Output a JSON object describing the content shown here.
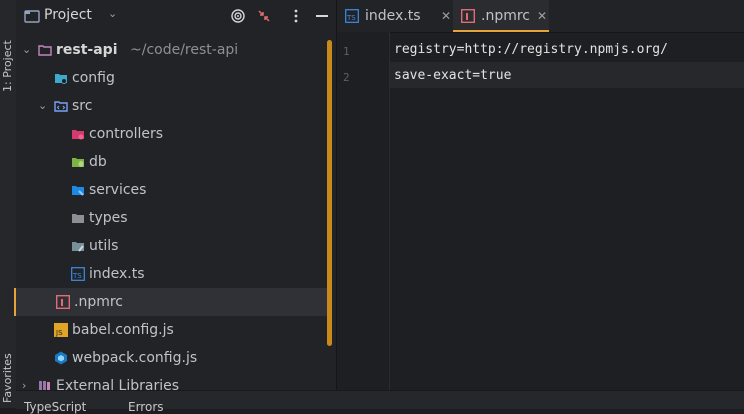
{
  "toolstrip": {
    "project_label": "1: Project",
    "favorites_label": "Favorites"
  },
  "project_panel": {
    "title": "Project",
    "tree": [
      {
        "label": "rest-api",
        "hint": "~/code/rest-api",
        "icon": "folder-icon"
      },
      {
        "label": "config",
        "icon": "folder-config-icon"
      },
      {
        "label": "src",
        "icon": "folder-source-icon"
      },
      {
        "label": "controllers",
        "icon": "folder-controllers-icon"
      },
      {
        "label": "db",
        "icon": "folder-db-icon"
      },
      {
        "label": "services",
        "icon": "folder-services-icon"
      },
      {
        "label": "types",
        "icon": "folder-icon"
      },
      {
        "label": "utils",
        "icon": "folder-utils-icon"
      },
      {
        "label": "index.ts",
        "icon": "typescript-file-icon"
      },
      {
        "label": ".npmrc",
        "icon": "npm-file-icon"
      },
      {
        "label": "babel.config.js",
        "icon": "javascript-file-icon"
      },
      {
        "label": "webpack.config.js",
        "icon": "webpack-file-icon"
      },
      {
        "label": "External Libraries",
        "icon": "libraries-icon"
      }
    ]
  },
  "bottom_tabs": [
    "TypeScript",
    "Errors"
  ],
  "editor": {
    "tabs": [
      {
        "label": "index.ts",
        "icon": "typescript-file-icon",
        "active": false
      },
      {
        "label": ".npmrc",
        "icon": "npm-file-icon",
        "active": true
      }
    ],
    "lines": [
      {
        "number": "1",
        "text": "registry=http://registry.npmjs.org/"
      },
      {
        "number": "2",
        "text": "save-exact=true"
      }
    ]
  },
  "colors": {
    "accent": "#e5a33a",
    "background": "#1e1f22",
    "panel": "#222326"
  }
}
